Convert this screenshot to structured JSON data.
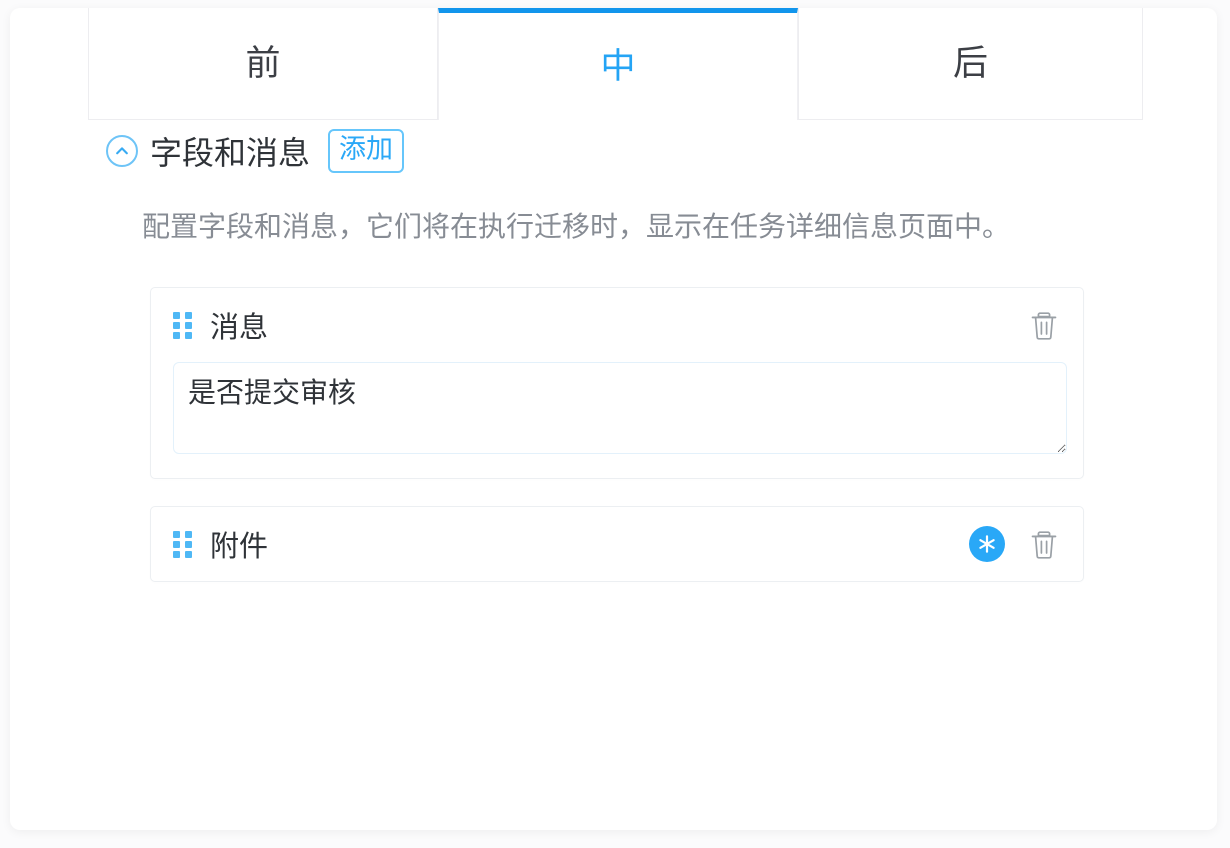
{
  "theme": {
    "accent": "#1195ec",
    "accent_light": "#29a8f7",
    "page_bg": "#fbfbfc",
    "panel_bg": "#ffffff",
    "text": "#2f3338",
    "muted_text": "#878c94",
    "border": "#eceff2",
    "handle_blue": "#4fb8f5"
  },
  "tabs": [
    {
      "label": "前",
      "active": false,
      "name": "tab-before"
    },
    {
      "label": "中",
      "active": true,
      "name": "tab-during"
    },
    {
      "label": "后",
      "active": false,
      "name": "tab-after"
    }
  ],
  "section": {
    "collapse_icon": "chevron-up-icon",
    "title": "字段和消息",
    "add_label": "添加",
    "description": "配置字段和消息，它们将在执行迁移时，显示在任务详细信息页面中。"
  },
  "cards": [
    {
      "name": "field-card-message",
      "drag_icon": "drag-handle-icon",
      "title": "消息",
      "required": false,
      "delete_icon": "trash-icon",
      "field": {
        "type": "textarea",
        "value": "是否提交审核",
        "placeholder": ""
      }
    },
    {
      "name": "field-card-attachment",
      "drag_icon": "drag-handle-icon",
      "title": "附件",
      "required": true,
      "required_icon": "asterisk-required-icon",
      "delete_icon": "trash-icon",
      "field": null
    }
  ]
}
